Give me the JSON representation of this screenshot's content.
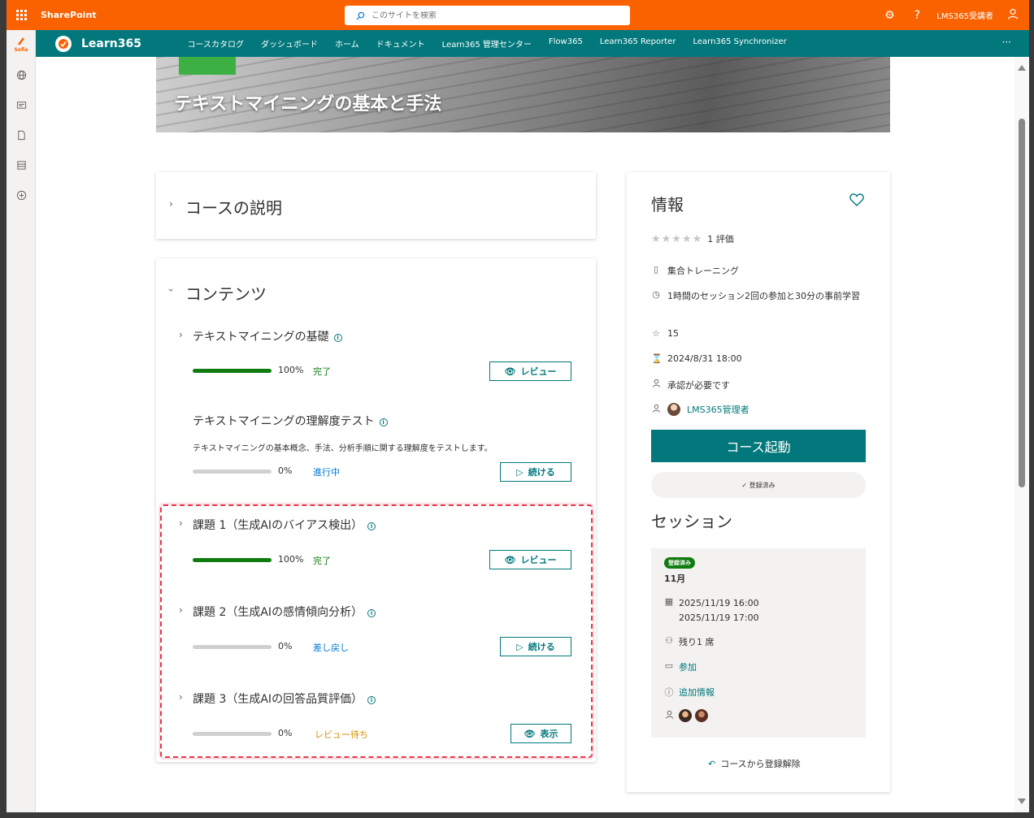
{
  "suite": {
    "brand": "SharePoint",
    "search_placeholder": "このサイトを検索",
    "user": "LMS365受講者",
    "help": "?"
  },
  "rail": {
    "logo": "Sofia"
  },
  "appbar": {
    "title": "Learn365",
    "nav": [
      "コースカタログ",
      "ダッシュボード",
      "ホーム",
      "ドキュメント",
      "Learn365 管理センター",
      "Flow365",
      "Learn365 Reporter",
      "Learn365 Synchronizer"
    ],
    "more": "···"
  },
  "hero": {
    "title": "テキストマイニングの基本と手法"
  },
  "description_section": {
    "title": "コースの説明"
  },
  "contents": {
    "title": "コンテンツ",
    "items": [
      {
        "title": "テキストマイニングの基礎",
        "progress": 100,
        "pct_label": "100%",
        "status": "完了",
        "status_color": "#107c10",
        "button": "レビュー",
        "button_icon": "eye-icon"
      },
      {
        "title": "テキストマイニングの理解度テスト",
        "description": "テキストマイニングの基本概念、手法、分析手順に関する理解度をテストします。",
        "progress": 0,
        "pct_label": "0%",
        "status": "進行中",
        "status_color": "#0078d4",
        "button": "続ける",
        "button_icon": "play-icon"
      },
      {
        "title": "課題 1（生成AIのバイアス検出）",
        "progress": 100,
        "pct_label": "100%",
        "status": "完了",
        "status_color": "#107c10",
        "button": "レビュー",
        "button_icon": "eye-icon"
      },
      {
        "title": "課題 2（生成AIの感情傾向分析）",
        "progress": 0,
        "pct_label": "0%",
        "status": "差し戻し",
        "status_color": "#0078d4",
        "button": "続ける",
        "button_icon": "play-icon"
      },
      {
        "title": "課題 3（生成AIの回答品質評価）",
        "progress": 0,
        "pct_label": "0%",
        "status": "レビュー待ち",
        "status_color": "#d29200",
        "button": "表示",
        "button_icon": "eye-icon"
      }
    ]
  },
  "info": {
    "title": "情報",
    "rating_stars": 0,
    "rating_label": "1 評価",
    "type": "集合トレーニング",
    "duration": "1時間のセッション2回の参加と30分の事前学習",
    "points": "15",
    "deadline": "2024/8/31 18:00",
    "approval": "承認が必要です",
    "admin": "LMS365管理者",
    "launch_button": "コース起動",
    "registered_button": "登録済み"
  },
  "session": {
    "title": "セッション",
    "badge": "登録済み",
    "month": "11月",
    "start": "2025/11/19 16:00",
    "end": "2025/11/19 17:00",
    "seats": "残り1 席",
    "join": "参加",
    "more_info": "追加情報",
    "unregister": "コースから登録解除"
  },
  "colors": {
    "suite_orange": "#fa6200",
    "teal": "#03787c",
    "green": "#107c10",
    "highlight_red": "#e8384f"
  }
}
